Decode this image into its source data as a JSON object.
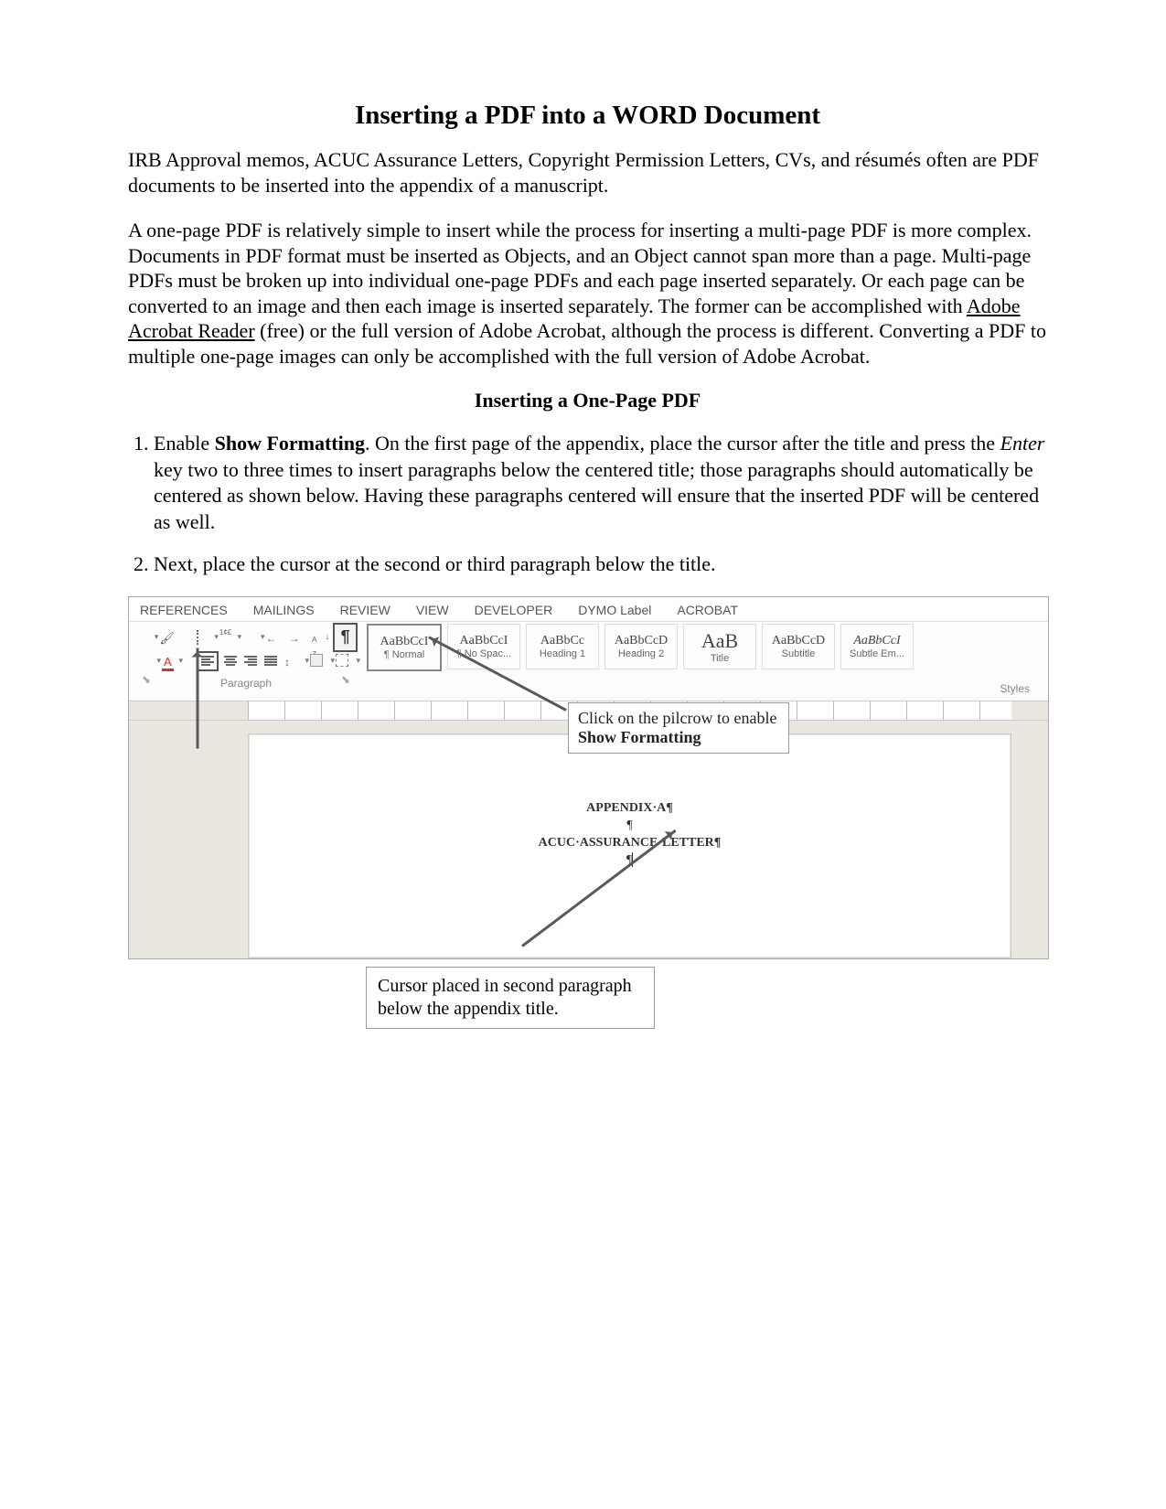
{
  "title": "Inserting a PDF into a WORD Document",
  "intro1": "IRB Approval memos, ACUC Assurance Letters, Copyright Permission Letters, CVs, and résumés often are PDF documents to be inserted into the appendix of a manuscript.",
  "intro2_a": "A one-page PDF is relatively simple to insert while the process for inserting a multi-page PDF is more complex. Documents in PDF format must be inserted as Objects, and an Object cannot span more than a page. Multi-page PDFs must be broken up into individual one-page PDFs and each page inserted separately. Or each page can be converted to an image and then each image is inserted separately. The former can be accomplished with ",
  "intro2_link": "Adobe Acrobat Reader",
  "intro2_b": " (free) or the full version of Adobe Acrobat, although the process is different. Converting a PDF to multiple one-page images can only be accomplished with the full version of Adobe Acrobat.",
  "subhead": "Inserting a One-Page PDF",
  "step1_a": "Enable ",
  "step1_bold": "Show Formatting",
  "step1_b": ". On the first page of the appendix, place the cursor after the title and press the ",
  "step1_italic": "Enter",
  "step1_c": " key two to three times to insert paragraphs below the centered title; those paragraphs should automatically be centered as shown below. Having these paragraphs centered will ensure that the inserted PDF will be centered as well.",
  "step2": "Next, place the cursor at the second or third paragraph below the title.",
  "ribbon": {
    "tabs": [
      "REFERENCES",
      "MAILINGS",
      "REVIEW",
      "VIEW",
      "DEVELOPER",
      "DYMO Label",
      "ACROBAT"
    ],
    "paragraph_label": "Paragraph",
    "styles_label": "Styles",
    "styles": [
      {
        "sample": "AaBbCcI",
        "name": "¶ Normal",
        "cls": "mid"
      },
      {
        "sample": "AaBbCcI",
        "name": "¶ No Spac...",
        "cls": "mid"
      },
      {
        "sample": "AaBbCc",
        "name": "Heading 1",
        "cls": "mid"
      },
      {
        "sample": "AaBbCcD",
        "name": "Heading 2",
        "cls": "mid"
      },
      {
        "sample": "AaB",
        "name": "Title",
        "cls": "big"
      },
      {
        "sample": "AaBbCcD",
        "name": "Subtitle",
        "cls": "mid"
      },
      {
        "sample": "AaBbCcI",
        "name": "Subtle Em...",
        "cls": "mid ital"
      }
    ]
  },
  "callout1_a": "Click on the pilcrow to enable ",
  "callout1_b": "Show Formatting",
  "doc": {
    "line1": "APPENDIX·A¶",
    "line2": "¶",
    "line3": "ACUC·ASSURANCE·LETTER¶",
    "line4": "¶"
  },
  "outer_callout": "Cursor placed in second paragraph below the appendix title."
}
